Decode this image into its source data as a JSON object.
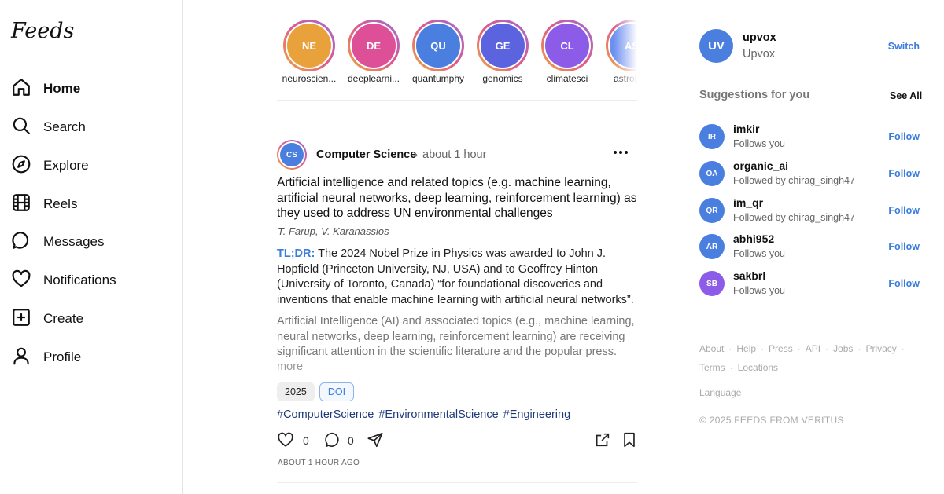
{
  "app": {
    "logo": "Feeds"
  },
  "nav": [
    {
      "label": "Home",
      "icon": "home-icon",
      "active": true
    },
    {
      "label": "Search",
      "icon": "search-icon"
    },
    {
      "label": "Explore",
      "icon": "compass-icon"
    },
    {
      "label": "Reels",
      "icon": "reels-icon"
    },
    {
      "label": "Messages",
      "icon": "message-icon"
    },
    {
      "label": "Notifications",
      "icon": "heart-icon"
    },
    {
      "label": "Create",
      "icon": "plus-square-icon"
    },
    {
      "label": "Profile",
      "icon": "user-icon"
    }
  ],
  "stories": [
    {
      "initials": "NE",
      "label": "neuroscien...",
      "color": "#e9a23b"
    },
    {
      "initials": "DE",
      "label": "deeplearni...",
      "color": "#dd4f96"
    },
    {
      "initials": "QU",
      "label": "quantumphy",
      "color": "#4a7fe0"
    },
    {
      "initials": "GE",
      "label": "genomics",
      "color": "#5b63de"
    },
    {
      "initials": "CL",
      "label": "climatesci",
      "color": "#8c5ce8"
    },
    {
      "initials": "AS",
      "label": "astrophy",
      "color": "#6c8ff0"
    }
  ],
  "post": {
    "avatar_initials": "CS",
    "author": "Computer Science",
    "separator": "•",
    "time": "about 1 hour",
    "title": "Artificial intelligence and related topics (e.g. machine learning, artificial neural networks, deep learning, reinforcement learning) as they used to address UN environmental challenges",
    "authors": "T. Farup, V. Karanassios",
    "tldr_label": "TL;DR:",
    "tldr": "The 2024 Nobel Prize in Physics was awarded to John J. Hopfield (Princeton University, NJ, USA) and to Geoffrey Hinton (University of Toronto, Canada) “for foundational discoveries and inventions that enable machine learning with artificial neural networks”.",
    "abstract": "Artificial Intelligence (AI) and associated topics (e.g., machine learning, neural networks, deep learning, reinforcement learning) are receiving significant attention in the scientific literature and the popular press. Fo...",
    "more_label": "more",
    "year_chip": "2025",
    "doi_chip": "DOI",
    "hashtags": [
      "#ComputerScience",
      "#EnvironmentalScience",
      "#Engineering"
    ],
    "likes": "0",
    "comments": "0",
    "footer_time": "ABOUT 1 HOUR AGO"
  },
  "me": {
    "initials": "UV",
    "username": "upvox_",
    "name": "Upvox",
    "switch_label": "Switch"
  },
  "suggestions": {
    "title": "Suggestions for you",
    "see_all": "See All",
    "items": [
      {
        "initials": "IR",
        "name": "imkir",
        "sub": "Follows you",
        "color": "#4a7fe0"
      },
      {
        "initials": "OA",
        "name": "organic_ai",
        "sub": "Followed by chirag_singh47",
        "color": "#4a7fe0"
      },
      {
        "initials": "QR",
        "name": "im_qr",
        "sub": "Followed by chirag_singh47",
        "color": "#4a7fe0"
      },
      {
        "initials": "AR",
        "name": "abhi952",
        "sub": "Follows you",
        "color": "#4a7fe0"
      },
      {
        "initials": "SB",
        "name": "sakbrl",
        "sub": "Follows you",
        "color": "#8c5ce8"
      }
    ],
    "follow_label": "Follow"
  },
  "footer": {
    "links_row1": [
      "About",
      "Help",
      "Press",
      "API",
      "Jobs",
      "Privacy"
    ],
    "links_row2": [
      "Terms",
      "Locations"
    ],
    "separator": "·",
    "language": "Language",
    "copyright": "© 2025 FEEDS FROM VERITUS"
  }
}
